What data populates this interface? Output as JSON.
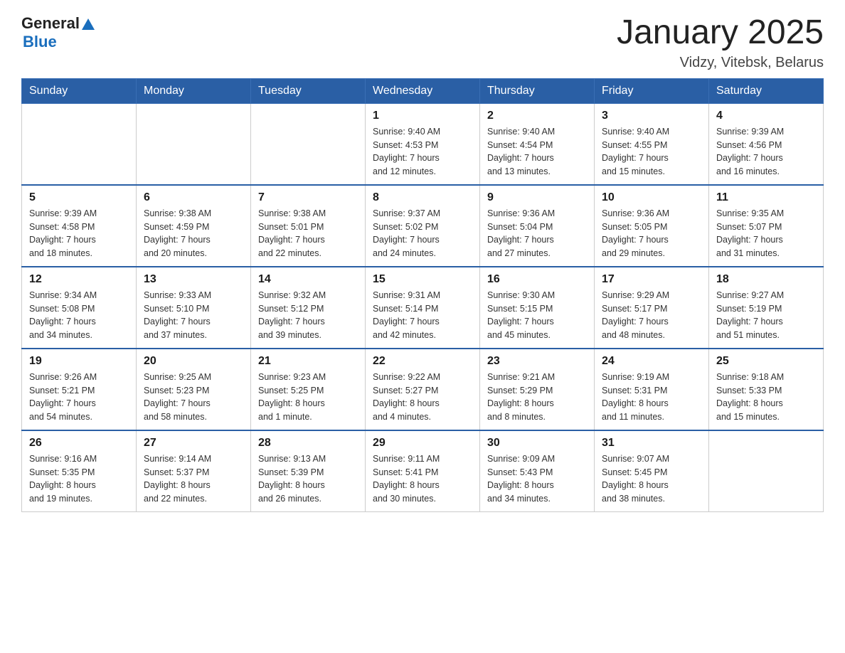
{
  "logo": {
    "general": "General",
    "blue": "Blue"
  },
  "header": {
    "month": "January 2025",
    "location": "Vidzy, Vitebsk, Belarus"
  },
  "weekdays": [
    "Sunday",
    "Monday",
    "Tuesday",
    "Wednesday",
    "Thursday",
    "Friday",
    "Saturday"
  ],
  "weeks": [
    [
      {
        "day": "",
        "info": ""
      },
      {
        "day": "",
        "info": ""
      },
      {
        "day": "",
        "info": ""
      },
      {
        "day": "1",
        "info": "Sunrise: 9:40 AM\nSunset: 4:53 PM\nDaylight: 7 hours\nand 12 minutes."
      },
      {
        "day": "2",
        "info": "Sunrise: 9:40 AM\nSunset: 4:54 PM\nDaylight: 7 hours\nand 13 minutes."
      },
      {
        "day": "3",
        "info": "Sunrise: 9:40 AM\nSunset: 4:55 PM\nDaylight: 7 hours\nand 15 minutes."
      },
      {
        "day": "4",
        "info": "Sunrise: 9:39 AM\nSunset: 4:56 PM\nDaylight: 7 hours\nand 16 minutes."
      }
    ],
    [
      {
        "day": "5",
        "info": "Sunrise: 9:39 AM\nSunset: 4:58 PM\nDaylight: 7 hours\nand 18 minutes."
      },
      {
        "day": "6",
        "info": "Sunrise: 9:38 AM\nSunset: 4:59 PM\nDaylight: 7 hours\nand 20 minutes."
      },
      {
        "day": "7",
        "info": "Sunrise: 9:38 AM\nSunset: 5:01 PM\nDaylight: 7 hours\nand 22 minutes."
      },
      {
        "day": "8",
        "info": "Sunrise: 9:37 AM\nSunset: 5:02 PM\nDaylight: 7 hours\nand 24 minutes."
      },
      {
        "day": "9",
        "info": "Sunrise: 9:36 AM\nSunset: 5:04 PM\nDaylight: 7 hours\nand 27 minutes."
      },
      {
        "day": "10",
        "info": "Sunrise: 9:36 AM\nSunset: 5:05 PM\nDaylight: 7 hours\nand 29 minutes."
      },
      {
        "day": "11",
        "info": "Sunrise: 9:35 AM\nSunset: 5:07 PM\nDaylight: 7 hours\nand 31 minutes."
      }
    ],
    [
      {
        "day": "12",
        "info": "Sunrise: 9:34 AM\nSunset: 5:08 PM\nDaylight: 7 hours\nand 34 minutes."
      },
      {
        "day": "13",
        "info": "Sunrise: 9:33 AM\nSunset: 5:10 PM\nDaylight: 7 hours\nand 37 minutes."
      },
      {
        "day": "14",
        "info": "Sunrise: 9:32 AM\nSunset: 5:12 PM\nDaylight: 7 hours\nand 39 minutes."
      },
      {
        "day": "15",
        "info": "Sunrise: 9:31 AM\nSunset: 5:14 PM\nDaylight: 7 hours\nand 42 minutes."
      },
      {
        "day": "16",
        "info": "Sunrise: 9:30 AM\nSunset: 5:15 PM\nDaylight: 7 hours\nand 45 minutes."
      },
      {
        "day": "17",
        "info": "Sunrise: 9:29 AM\nSunset: 5:17 PM\nDaylight: 7 hours\nand 48 minutes."
      },
      {
        "day": "18",
        "info": "Sunrise: 9:27 AM\nSunset: 5:19 PM\nDaylight: 7 hours\nand 51 minutes."
      }
    ],
    [
      {
        "day": "19",
        "info": "Sunrise: 9:26 AM\nSunset: 5:21 PM\nDaylight: 7 hours\nand 54 minutes."
      },
      {
        "day": "20",
        "info": "Sunrise: 9:25 AM\nSunset: 5:23 PM\nDaylight: 7 hours\nand 58 minutes."
      },
      {
        "day": "21",
        "info": "Sunrise: 9:23 AM\nSunset: 5:25 PM\nDaylight: 8 hours\nand 1 minute."
      },
      {
        "day": "22",
        "info": "Sunrise: 9:22 AM\nSunset: 5:27 PM\nDaylight: 8 hours\nand 4 minutes."
      },
      {
        "day": "23",
        "info": "Sunrise: 9:21 AM\nSunset: 5:29 PM\nDaylight: 8 hours\nand 8 minutes."
      },
      {
        "day": "24",
        "info": "Sunrise: 9:19 AM\nSunset: 5:31 PM\nDaylight: 8 hours\nand 11 minutes."
      },
      {
        "day": "25",
        "info": "Sunrise: 9:18 AM\nSunset: 5:33 PM\nDaylight: 8 hours\nand 15 minutes."
      }
    ],
    [
      {
        "day": "26",
        "info": "Sunrise: 9:16 AM\nSunset: 5:35 PM\nDaylight: 8 hours\nand 19 minutes."
      },
      {
        "day": "27",
        "info": "Sunrise: 9:14 AM\nSunset: 5:37 PM\nDaylight: 8 hours\nand 22 minutes."
      },
      {
        "day": "28",
        "info": "Sunrise: 9:13 AM\nSunset: 5:39 PM\nDaylight: 8 hours\nand 26 minutes."
      },
      {
        "day": "29",
        "info": "Sunrise: 9:11 AM\nSunset: 5:41 PM\nDaylight: 8 hours\nand 30 minutes."
      },
      {
        "day": "30",
        "info": "Sunrise: 9:09 AM\nSunset: 5:43 PM\nDaylight: 8 hours\nand 34 minutes."
      },
      {
        "day": "31",
        "info": "Sunrise: 9:07 AM\nSunset: 5:45 PM\nDaylight: 8 hours\nand 38 minutes."
      },
      {
        "day": "",
        "info": ""
      }
    ]
  ]
}
